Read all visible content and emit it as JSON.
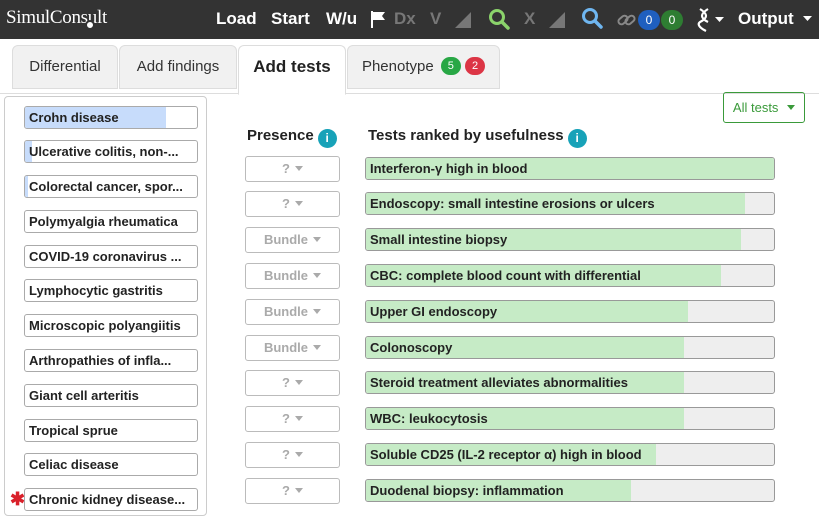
{
  "topbar": {
    "logo": "SimulConsult",
    "load": "Load",
    "start": "Start",
    "wu": "W/u",
    "dx": "Dx",
    "v": "V",
    "x": "X",
    "count_blue": "0",
    "count_green": "0",
    "output": "Output"
  },
  "tabs": [
    {
      "label": "Differential"
    },
    {
      "label": "Add findings"
    },
    {
      "label": "Add tests"
    },
    {
      "label": "Phenotype",
      "badge_green": "5",
      "badge_red": "2"
    }
  ],
  "filter_button": "All tests",
  "presence_header": "Presence",
  "tests_header": "Tests ranked by usefulness",
  "info_glyph": "i",
  "diagnoses": [
    {
      "label": "Crohn disease",
      "level": 0.82,
      "starred": false
    },
    {
      "label": "Ulcerative colitis, non-...",
      "level": 0.04,
      "starred": false
    },
    {
      "label": "Colorectal cancer, spor...",
      "level": 0.02,
      "starred": false
    },
    {
      "label": "Polymyalgia rheumatica",
      "level": 0.0,
      "starred": false
    },
    {
      "label": "COVID-19 coronavirus ...",
      "level": 0.0,
      "starred": false
    },
    {
      "label": "Lymphocytic gastritis",
      "level": 0.0,
      "starred": false
    },
    {
      "label": "Microscopic polyangiitis",
      "level": 0.0,
      "starred": false
    },
    {
      "label": "Arthropathies of infla...",
      "level": 0.0,
      "starred": false
    },
    {
      "label": "Giant cell arteritis",
      "level": 0.0,
      "starred": false
    },
    {
      "label": "Tropical sprue",
      "level": 0.0,
      "starred": false
    },
    {
      "label": "Celiac disease",
      "level": 0.0,
      "starred": false
    },
    {
      "label": "Chronic kidney disease...",
      "level": 0.0,
      "starred": true
    }
  ],
  "tests": [
    {
      "label": "Interferon-γ high in blood",
      "presence": "?",
      "usefulness": 1.0
    },
    {
      "label": "Endoscopy: small intestine erosions or ulcers",
      "presence": "?",
      "usefulness": 0.93
    },
    {
      "label": "Small intestine biopsy",
      "presence": "Bundle",
      "usefulness": 0.92
    },
    {
      "label": "CBC: complete blood count with differential",
      "presence": "Bundle",
      "usefulness": 0.87
    },
    {
      "label": "Upper GI endoscopy",
      "presence": "Bundle",
      "usefulness": 0.79
    },
    {
      "label": "Colonoscopy",
      "presence": "Bundle",
      "usefulness": 0.78
    },
    {
      "label": "Steroid treatment alleviates abnormalities",
      "presence": "?",
      "usefulness": 0.78
    },
    {
      "label": "WBC: leukocytosis",
      "presence": "?",
      "usefulness": 0.78
    },
    {
      "label": "Soluble CD25 (IL-2 receptor α) high in blood",
      "presence": "?",
      "usefulness": 0.71
    },
    {
      "label": "Duodenal biopsy: inflammation",
      "presence": "?",
      "usefulness": 0.65
    }
  ],
  "colors": {
    "topbar": "#333333",
    "accent_green": "#3a9a3a",
    "info": "#17a2b8",
    "dx_fill": "#c7dcfb",
    "test_fill": "#c6ebc6",
    "badge_green": "#28a745",
    "badge_red": "#dc3545",
    "pill_blue": "#1f5fbf",
    "pill_green": "#2e7d32"
  }
}
